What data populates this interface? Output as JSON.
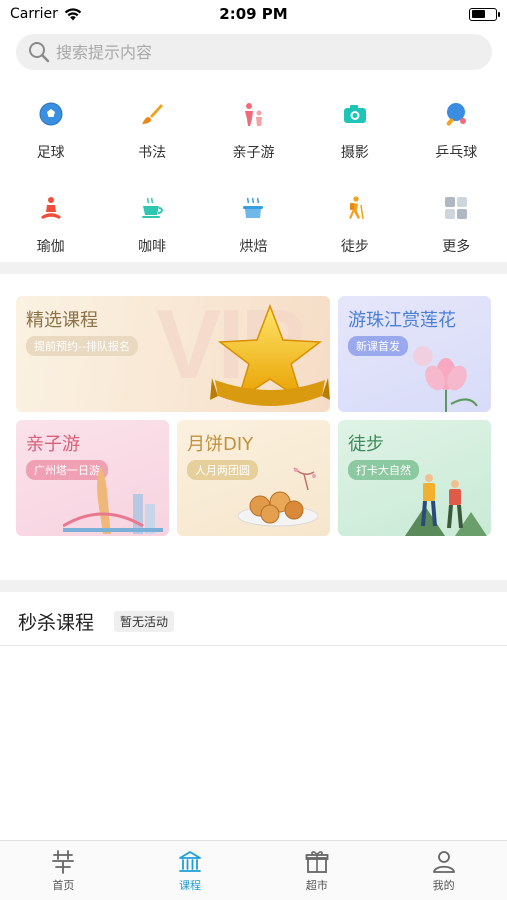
{
  "status_bar": {
    "carrier": "Carrier",
    "time": "2:09 PM",
    "battery_level": 0.6
  },
  "search": {
    "placeholder": "搜索提示内容"
  },
  "categories": [
    {
      "label": "足球",
      "icon": "soccer-ball-icon",
      "color": "#3b8fe0"
    },
    {
      "label": "书法",
      "icon": "brush-icon",
      "color": "#f2a21c"
    },
    {
      "label": "亲子游",
      "icon": "parent-child-icon",
      "color": "#f26a7a"
    },
    {
      "label": "摄影",
      "icon": "camera-icon",
      "color": "#1cc5b5"
    },
    {
      "label": "乒乓球",
      "icon": "ping-pong-icon",
      "color": "#3a8de0"
    },
    {
      "label": "瑜伽",
      "icon": "yoga-icon",
      "color": "#f24d3a"
    },
    {
      "label": "咖啡",
      "icon": "coffee-cup-icon",
      "color": "#2fc7b0"
    },
    {
      "label": "烘焙",
      "icon": "baking-pot-icon",
      "color": "#3a9de0"
    },
    {
      "label": "徒步",
      "icon": "hiking-icon",
      "color": "#f2a21c"
    },
    {
      "label": "更多",
      "icon": "more-grid-icon",
      "color": "#b0b8c4"
    }
  ],
  "cards": {
    "featured": {
      "title": "精选课程",
      "tag": "提前预约--排队报名",
      "watermark": "VIP"
    },
    "lotus": {
      "title": "游珠江赏莲花",
      "tag": "新课首发"
    },
    "family": {
      "title": "亲子游",
      "tag": "广州塔一日游"
    },
    "mooncake": {
      "title": "月饼DIY",
      "tag": "人月两团圆"
    },
    "hiking": {
      "title": "徒步",
      "tag": "打卡大自然"
    }
  },
  "seckill": {
    "title": "秒杀课程",
    "badge": "暂无活动"
  },
  "tabs": [
    {
      "label": "首页",
      "icon": "home-icon",
      "active": false
    },
    {
      "label": "课程",
      "icon": "course-building-icon",
      "active": true
    },
    {
      "label": "超市",
      "icon": "gift-icon",
      "active": false
    },
    {
      "label": "我的",
      "icon": "user-icon",
      "active": false
    }
  ]
}
